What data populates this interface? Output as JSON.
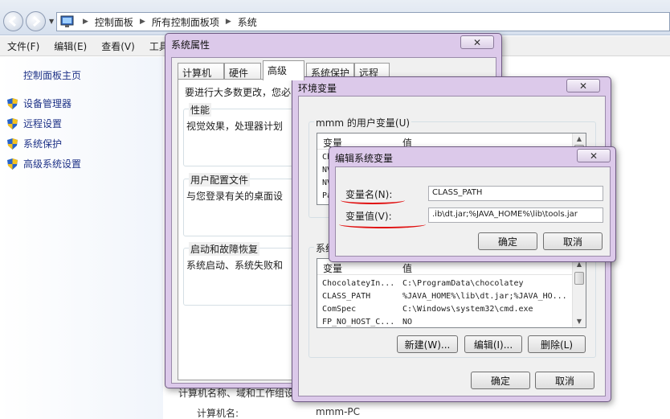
{
  "explorer": {
    "breadcrumbs": [
      "控制面板",
      "所有控制面板项",
      "系统"
    ],
    "menu": [
      "文件(F)",
      "编辑(E)",
      "查看(V)",
      "工具"
    ],
    "left_pane": {
      "home": "控制面板主页",
      "links": [
        "设备管理器",
        "远程设置",
        "系统保护",
        "高级系统设置"
      ]
    },
    "background": {
      "section_text": "计算机名称、域和工作组设",
      "computer_name_label": "计算机名:",
      "computer_name_value": "mmm-PC"
    }
  },
  "system_properties": {
    "title": "系统属性",
    "tabs": [
      "计算机名",
      "硬件",
      "高级",
      "系统保护",
      "远程"
    ],
    "active_tab": "高级",
    "intro": "要进行大多数更改，您必",
    "groups": [
      {
        "title": "性能",
        "desc": "视觉效果，处理器计划"
      },
      {
        "title": "用户配置文件",
        "desc": "与您登录有关的桌面设"
      },
      {
        "title": "启动和故障恢复",
        "desc": "系统启动、系统失败和"
      }
    ]
  },
  "env_vars": {
    "title": "环境变量",
    "user_group": "mmm 的用户变量(U)",
    "system_group": "系统",
    "columns": [
      "变量",
      "值"
    ],
    "user_rows": [
      {
        "name": "Ch",
        "value": ""
      },
      {
        "name": "NV",
        "value": ""
      },
      {
        "name": "NV",
        "value": ""
      },
      {
        "name": "Pa",
        "value": ""
      }
    ],
    "system_rows": [
      {
        "name": "ChocolateyIn...",
        "value": "C:\\ProgramData\\chocolatey"
      },
      {
        "name": "CLASS_PATH",
        "value": "%JAVA_HOME%\\lib\\dt.jar;%JAVA_HO..."
      },
      {
        "name": "ComSpec",
        "value": "C:\\Windows\\system32\\cmd.exe"
      },
      {
        "name": "FP_NO_HOST_C...",
        "value": "NO"
      }
    ],
    "buttons": {
      "new": "新建(W)...",
      "edit": "编辑(I)...",
      "delete": "删除(L)"
    },
    "ok": "确定",
    "cancel": "取消"
  },
  "edit_var": {
    "title": "编辑系统变量",
    "name_label": "变量名(N):",
    "value_label": "变量值(V):",
    "name_value": "CLASS_PATH",
    "value_value": ".ib\\dt.jar;%JAVA_HOME%\\lib\\tools.jar",
    "ok": "确定",
    "cancel": "取消",
    "annotation_color": "#e01010"
  },
  "close_glyph": "✕"
}
